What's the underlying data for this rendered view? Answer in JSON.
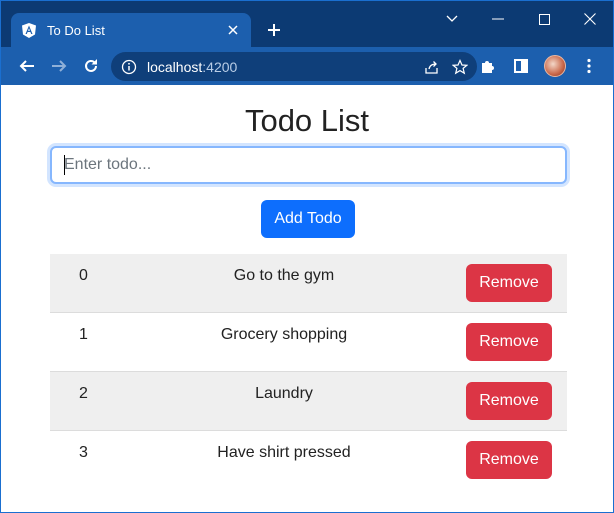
{
  "browser": {
    "tab_title": "To Do List",
    "url_host": "localhost",
    "url_port": ":4200",
    "favicon": "angular-icon",
    "colors": {
      "tab_strip": "#0c3a73",
      "toolbar": "#1c5fae",
      "omnibox": "#0f3f7a"
    }
  },
  "page": {
    "title": "Todo List",
    "input": {
      "placeholder": "Enter todo...",
      "value": ""
    },
    "add_button_label": "Add Todo",
    "todos": [
      {
        "index": "0",
        "text": "Go to the gym",
        "remove_label": "Remove"
      },
      {
        "index": "1",
        "text": "Grocery shopping",
        "remove_label": "Remove"
      },
      {
        "index": "2",
        "text": "Laundry",
        "remove_label": "Remove"
      },
      {
        "index": "3",
        "text": "Have shirt pressed",
        "remove_label": "Remove"
      }
    ],
    "colors": {
      "primary": "#0d6efd",
      "danger": "#dc3545",
      "stripe": "#efefef"
    }
  }
}
